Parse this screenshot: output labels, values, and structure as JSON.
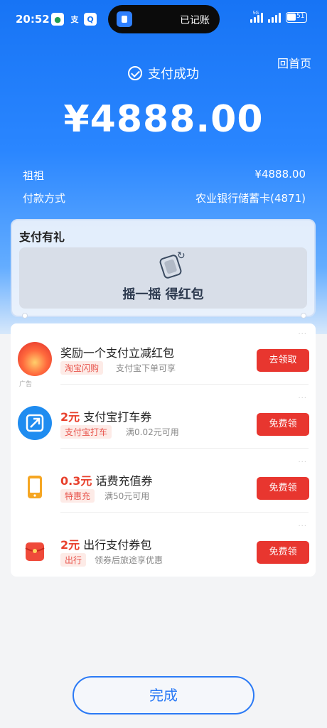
{
  "status_bar": {
    "time": "20:52",
    "island_text": "已记账",
    "network": "5G",
    "battery": "51"
  },
  "header": {
    "home_link": "回首页",
    "success_text": "支付成功",
    "amount": "¥4888.00"
  },
  "details": {
    "payee_label": "祖祖",
    "payee_amount": "¥4888.00",
    "method_label": "付款方式",
    "method_value": "农业银行储蓄卡(4871)"
  },
  "gift": {
    "title": "支付有礼",
    "shake_text": "摇一摇 得红包"
  },
  "coupons": [
    {
      "title_prefix": "",
      "title": "奖励一个支付立减红包",
      "tag": "淘宝闪购",
      "desc": "支付宝下单可享",
      "button": "去领取",
      "ad": "广告"
    },
    {
      "title_prefix": "2元",
      "title": " 支付宝打车券",
      "tag": "支付宝打车",
      "desc": "满0.02元可用",
      "button": "免费领"
    },
    {
      "title_prefix": "0.3元",
      "title": " 话费充值券",
      "tag": "特惠充",
      "desc": "满50元可用",
      "button": "免费领"
    },
    {
      "title_prefix": "2元",
      "title": " 出行支付券包",
      "tag": "出行",
      "desc": "领券后旅途享优惠",
      "button": "免费领"
    }
  ],
  "footer": {
    "done_label": "完成"
  },
  "colors": {
    "brand_blue": "#1774f5",
    "button_red": "#e8362f"
  }
}
